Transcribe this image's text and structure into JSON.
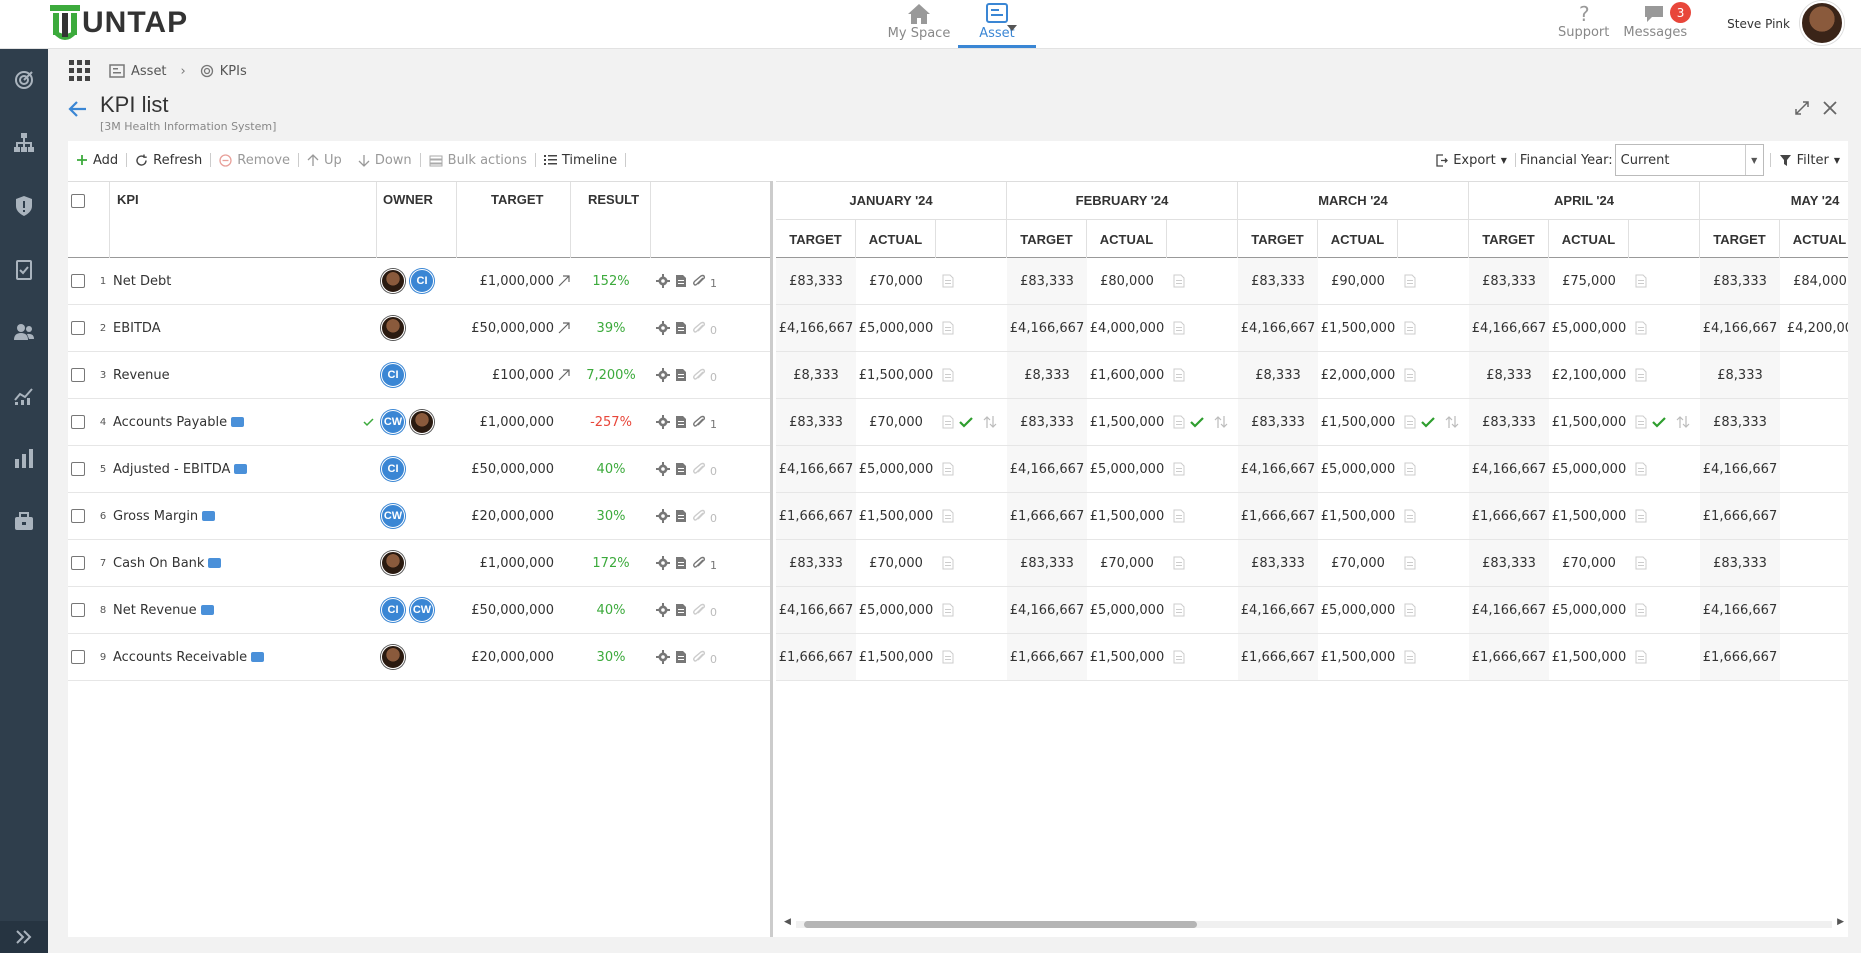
{
  "brand": {
    "name": "UNTAP"
  },
  "topnav": {
    "my_space": "My Space",
    "asset": "Asset"
  },
  "topright": {
    "support": "Support",
    "messages": "Messages",
    "messages_count": "3",
    "user_name": "Steve Pink"
  },
  "breadcrumb": {
    "asset": "Asset",
    "kpis": "KPIs"
  },
  "page": {
    "title": "KPI list",
    "subtitle": "[3M Health Information System]"
  },
  "toolbar": {
    "add": "Add",
    "refresh": "Refresh",
    "remove": "Remove",
    "up": "Up",
    "down": "Down",
    "bulk_actions": "Bulk actions",
    "timeline": "Timeline",
    "export": "Export",
    "financial_year_label": "Financial Year:",
    "financial_year_value": "Current",
    "filter": "Filter"
  },
  "grid": {
    "headers": {
      "kpi": "KPI",
      "owner": "OWNER",
      "target": "TARGET",
      "result": "RESULT"
    },
    "months": [
      "JANUARY '24",
      "FEBRUARY '24",
      "MARCH '24",
      "APRIL '24",
      "MAY '24"
    ],
    "sub_headers": {
      "target": "TARGET",
      "actual": "ACTUAL"
    },
    "rows": [
      {
        "num": "1",
        "kpi": "Net Debt",
        "badge": false,
        "check": false,
        "owners": [
          "photo",
          "CI"
        ],
        "target": "£1,000,000",
        "trend": true,
        "result": "152%",
        "result_color": "green",
        "attach_count": "1",
        "attach_active": true,
        "months": [
          [
            "£83,333",
            "£70,000"
          ],
          [
            "£83,333",
            "£80,000"
          ],
          [
            "£83,333",
            "£90,000"
          ],
          [
            "£83,333",
            "£75,000"
          ],
          [
            "£83,333",
            "£84,000"
          ]
        ],
        "approved": false
      },
      {
        "num": "2",
        "kpi": "EBITDA",
        "badge": false,
        "check": false,
        "owners": [
          "photo"
        ],
        "target": "£50,000,000",
        "trend": true,
        "result": "39%",
        "result_color": "green",
        "attach_count": "0",
        "attach_active": false,
        "months": [
          [
            "£4,166,667",
            "£5,000,000"
          ],
          [
            "£4,166,667",
            "£4,000,000"
          ],
          [
            "£4,166,667",
            "£1,500,000"
          ],
          [
            "£4,166,667",
            "£5,000,000"
          ],
          [
            "£4,166,667",
            "£4,200,00"
          ]
        ],
        "approved": false
      },
      {
        "num": "3",
        "kpi": "Revenue",
        "badge": false,
        "check": false,
        "owners": [
          "CI"
        ],
        "target": "£100,000",
        "trend": true,
        "result": "7,200%",
        "result_color": "green",
        "attach_count": "0",
        "attach_active": false,
        "months": [
          [
            "£8,333",
            "£1,500,000"
          ],
          [
            "£8,333",
            "£1,600,000"
          ],
          [
            "£8,333",
            "£2,000,000"
          ],
          [
            "£8,333",
            "£2,100,000"
          ],
          [
            "£8,333",
            ""
          ]
        ],
        "approved": false
      },
      {
        "num": "4",
        "kpi": "Accounts Payable",
        "badge": true,
        "check": true,
        "owners": [
          "CW",
          "photo"
        ],
        "target": "£1,000,000",
        "trend": false,
        "result": "-257%",
        "result_color": "red",
        "attach_count": "1",
        "attach_active": true,
        "months": [
          [
            "£83,333",
            "£70,000"
          ],
          [
            "£83,333",
            "£1,500,000"
          ],
          [
            "£83,333",
            "£1,500,000"
          ],
          [
            "£83,333",
            "£1,500,000"
          ],
          [
            "£83,333",
            ""
          ]
        ],
        "approved": true
      },
      {
        "num": "5",
        "kpi": "Adjusted - EBITDA",
        "badge": true,
        "check": false,
        "owners": [
          "CI"
        ],
        "target": "£50,000,000",
        "trend": false,
        "result": "40%",
        "result_color": "green",
        "attach_count": "0",
        "attach_active": false,
        "months": [
          [
            "£4,166,667",
            "£5,000,000"
          ],
          [
            "£4,166,667",
            "£5,000,000"
          ],
          [
            "£4,166,667",
            "£5,000,000"
          ],
          [
            "£4,166,667",
            "£5,000,000"
          ],
          [
            "£4,166,667",
            ""
          ]
        ],
        "approved": false
      },
      {
        "num": "6",
        "kpi": "Gross Margin",
        "badge": true,
        "check": false,
        "owners": [
          "CW"
        ],
        "target": "£20,000,000",
        "trend": false,
        "result": "30%",
        "result_color": "green",
        "attach_count": "0",
        "attach_active": false,
        "months": [
          [
            "£1,666,667",
            "£1,500,000"
          ],
          [
            "£1,666,667",
            "£1,500,000"
          ],
          [
            "£1,666,667",
            "£1,500,000"
          ],
          [
            "£1,666,667",
            "£1,500,000"
          ],
          [
            "£1,666,667",
            ""
          ]
        ],
        "approved": false
      },
      {
        "num": "7",
        "kpi": "Cash On Bank",
        "badge": true,
        "check": false,
        "owners": [
          "photo"
        ],
        "target": "£1,000,000",
        "trend": false,
        "result": "172%",
        "result_color": "green",
        "attach_count": "1",
        "attach_active": true,
        "months": [
          [
            "£83,333",
            "£70,000"
          ],
          [
            "£83,333",
            "£70,000"
          ],
          [
            "£83,333",
            "£70,000"
          ],
          [
            "£83,333",
            "£70,000"
          ],
          [
            "£83,333",
            ""
          ]
        ],
        "approved": false
      },
      {
        "num": "8",
        "kpi": "Net Revenue",
        "badge": true,
        "check": false,
        "owners": [
          "CI",
          "CW"
        ],
        "target": "£50,000,000",
        "trend": false,
        "result": "40%",
        "result_color": "green",
        "attach_count": "0",
        "attach_active": false,
        "months": [
          [
            "£4,166,667",
            "£5,000,000"
          ],
          [
            "£4,166,667",
            "£5,000,000"
          ],
          [
            "£4,166,667",
            "£5,000,000"
          ],
          [
            "£4,166,667",
            "£5,000,000"
          ],
          [
            "£4,166,667",
            ""
          ]
        ],
        "approved": false
      },
      {
        "num": "9",
        "kpi": "Accounts Receivable",
        "badge": true,
        "check": false,
        "owners": [
          "photo"
        ],
        "target": "£20,000,000",
        "trend": false,
        "result": "30%",
        "result_color": "green",
        "attach_count": "0",
        "attach_active": false,
        "months": [
          [
            "£1,666,667",
            "£1,500,000"
          ],
          [
            "£1,666,667",
            "£1,500,000"
          ],
          [
            "£1,666,667",
            "£1,500,000"
          ],
          [
            "£1,666,667",
            "£1,500,000"
          ],
          [
            "£1,666,667",
            ""
          ]
        ],
        "approved": false
      }
    ]
  },
  "colors": {
    "accent": "#3a86d4",
    "sidebar": "#2f3e4c",
    "green": "#3caa3c",
    "red": "#e8463a",
    "badge": "#e8463a"
  },
  "icons": {
    "my_space": "home-icon",
    "asset": "asset-board-icon",
    "support": "question-icon",
    "messages": "chat-bubble-icon"
  }
}
